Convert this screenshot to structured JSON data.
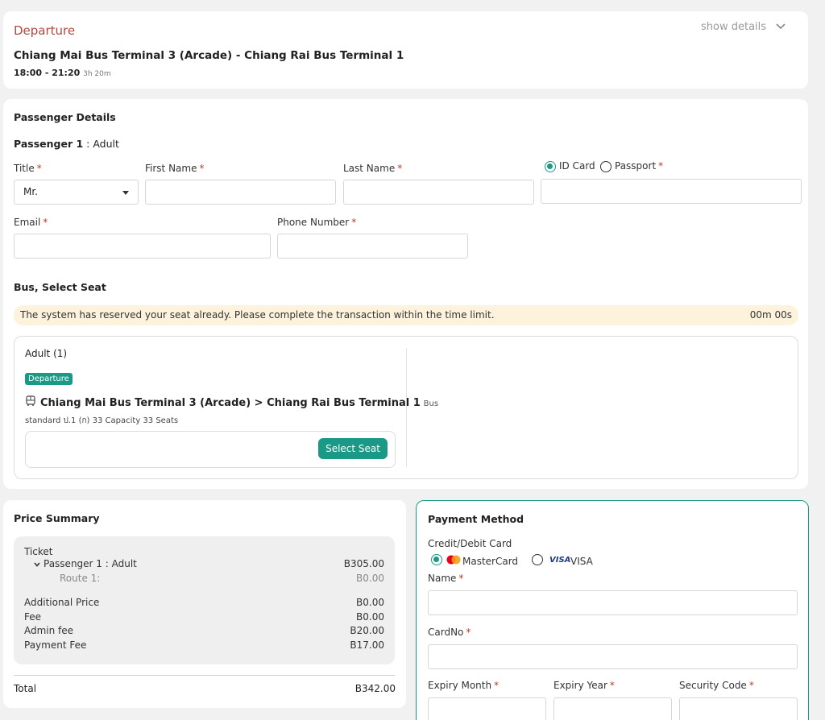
{
  "departure": {
    "heading": "Departure",
    "show_details": "show details",
    "route": "Chiang Mai Bus Terminal 3 (Arcade) - Chiang Rai Bus Terminal 1",
    "time": "18:00 - 21:20",
    "duration": "3h 20m"
  },
  "passenger": {
    "section_title": "Passenger Details",
    "passenger_label": "Passenger 1",
    "passenger_type": " : Adult",
    "title_label": "Title",
    "title_value": "Mr.",
    "first_name_label": "First Name",
    "last_name_label": "Last Name",
    "id_card_label": "ID Card",
    "passport_label": "Passport",
    "email_label": "Email",
    "phone_label": "Phone Number"
  },
  "seat": {
    "section_title": "Bus, Select Seat",
    "notice": "The system has reserved your seat already. Please complete the transaction within the time limit.",
    "timer": "00m 00s",
    "adult_label": "Adult (1)",
    "departure_badge": "Departure",
    "route": "Chiang Mai Bus Terminal 3 (Arcade) > Chiang Rai Bus Terminal 1",
    "bus_label": "Bus",
    "bus_detail": "standard ป.1 (ก) 33 Capacity 33 Seats",
    "select_seat_button": "Select Seat"
  },
  "price": {
    "section_title": "Price Summary",
    "ticket_label": "Ticket",
    "passenger_label": "Passenger 1 : Adult",
    "passenger_value": "B305.00",
    "route_label": "Route 1:",
    "route_value": "B0.00",
    "additional_label": "Additional Price",
    "additional_value": "B0.00",
    "fee_label": "Fee",
    "fee_value": "B0.00",
    "admin_label": "Admin fee",
    "admin_value": "B20.00",
    "payment_fee_label": "Payment Fee",
    "payment_fee_value": "B17.00",
    "total_label": "Total",
    "total_value": "B342.00"
  },
  "payment": {
    "section_title": "Payment Method",
    "card_label": "Credit/Debit Card",
    "mastercard_label": "MasterCard",
    "visa_logo": "VISA",
    "visa_label": "VISA",
    "name_label": "Name",
    "cardno_label": "CardNo",
    "expiry_month_label": "Expiry Month",
    "expiry_year_label": "Expiry Year",
    "security_label": "Security Code"
  },
  "colors": {
    "accent": "#1a9a86",
    "heading_red": "#b24a3c",
    "notice_bg": "#fdf3dd"
  }
}
